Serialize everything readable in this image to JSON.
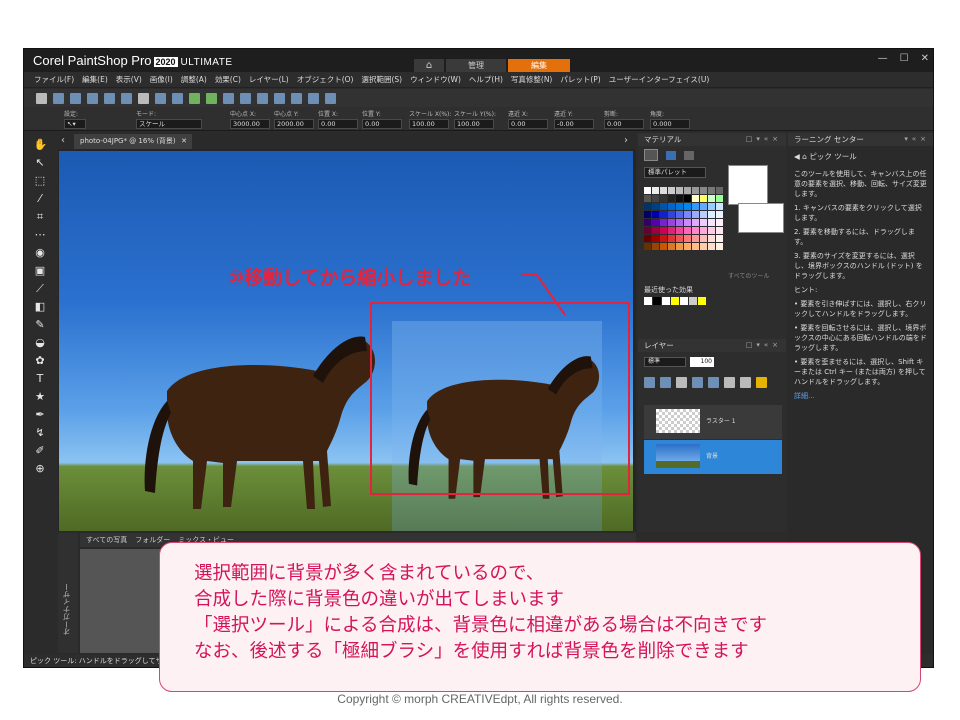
{
  "app": {
    "brand": "Corel PaintShop Pro",
    "version": "2020",
    "edition": "ULTIMATE",
    "tabs": [
      "管理",
      "編集"
    ],
    "window_controls": [
      "—",
      "☐",
      "✕"
    ]
  },
  "menu": [
    "ファイル(F)",
    "編集(E)",
    "表示(V)",
    "画像(I)",
    "調整(A)",
    "効果(C)",
    "レイヤー(L)",
    "オブジェクト(O)",
    "選択範囲(S)",
    "ウィンドウ(W)",
    "ヘルプ(H)",
    "写真修整(N)",
    "パレット(P)",
    "ユーザーインターフェイス(U)"
  ],
  "options": {
    "preset_label": "設定:",
    "mode_label": "モード:",
    "mode_value": "スケール",
    "center_x_label": "中心点 X:",
    "center_x": "3000.00",
    "center_y_label": "中心点 Y:",
    "center_y": "2000.00",
    "pos_x_label": "位置 X:",
    "pos_x": "0.00",
    "pos_y_label": "位置 Y:",
    "pos_y": "0.00",
    "scale_x_label": "スケール X(%):",
    "scale_x": "100.00",
    "scale_y_label": "スケール Y(%):",
    "scale_y": "100.00",
    "skew_x_label": "遠近 X:",
    "skew_x": "0.00",
    "skew_y_label": "遠近 Y:",
    "skew_y": "-0.00",
    "shear_label": "剪断:",
    "shear": "0.00",
    "angle_label": "角度:",
    "angle": "0.000"
  },
  "document": {
    "tab_title": "photo-04JPG* @ 16% (背景)",
    "close": "✕"
  },
  "annotation_text": "⑩移動してから縮小しました",
  "organizer": {
    "side_label": "オーガナイザー",
    "bar_labels": [
      "すべての写真",
      "フォルダー",
      "ミックス・ビュー"
    ]
  },
  "materials": {
    "title": "マテリアル",
    "palette_select": "標準パレット",
    "all_tools": "すべてのツール",
    "recent_label": "最近使った効果",
    "swatches": [
      "#ffffff",
      "#eeeeee",
      "#dddddd",
      "#cccccc",
      "#bbbbbb",
      "#aaaaaa",
      "#999999",
      "#888888",
      "#777777",
      "#666666",
      "#555555",
      "#444444",
      "#333333",
      "#222222",
      "#111111",
      "#000000",
      "#ffffcc",
      "#ffff66",
      "#ccffcc",
      "#99ff99",
      "#003366",
      "#004080",
      "#0055aa",
      "#0066cc",
      "#0077dd",
      "#0088ee",
      "#3399ff",
      "#66aaff",
      "#99ccff",
      "#cce6ff",
      "#000066",
      "#0000aa",
      "#1122cc",
      "#3344dd",
      "#5566ee",
      "#7788ff",
      "#99aaff",
      "#bbccff",
      "#ddeeff",
      "#eef4ff",
      "#330066",
      "#5500aa",
      "#7722cc",
      "#9944dd",
      "#aa66ee",
      "#cc88ff",
      "#ddaaff",
      "#eeccff",
      "#f4e6ff",
      "#fff0ff",
      "#660033",
      "#990044",
      "#cc0055",
      "#dd2277",
      "#ee4499",
      "#ff66bb",
      "#ff88cc",
      "#ffaadd",
      "#ffcce6",
      "#ffe6f2",
      "#660000",
      "#990000",
      "#cc1111",
      "#dd3333",
      "#ee5555",
      "#ff7777",
      "#ff9999",
      "#ffbbbb",
      "#ffdddd",
      "#fff0f0",
      "#663300",
      "#994400",
      "#cc5500",
      "#dd7722",
      "#ee9944",
      "#ffaa66",
      "#ffbb88",
      "#ffccaa",
      "#ffddcc",
      "#fff0e6"
    ],
    "recent": [
      "#ffffff",
      "#000000",
      "#ffffff",
      "#ffff00",
      "#ffffff",
      "#cccccc",
      "#ffff00"
    ]
  },
  "layers": {
    "title": "レイヤー",
    "blend": "標準",
    "opacity": "100",
    "items": [
      "ラスター 1",
      "背景"
    ]
  },
  "learning": {
    "title": "ラーニング センター",
    "section": "ピック ツール",
    "intro": "このツールを使用して、キャンバス上の任意の要素を選択、移動、回転、サイズ変更します。",
    "steps": [
      "1. キャンバスの要素をクリックして選択します。",
      "2. 要素を移動するには、ドラッグします。",
      "3. 要素のサイズを変更するには、選択し、境界ボックスのハンドル (ドット) をドラッグします。"
    ],
    "hint_title": "ヒント:",
    "hints": [
      "• 要素を引き伸ばすには、選択し、右クリックしてハンドルをドラッグします。",
      "• 要素を回転させるには、選択し、境界ボックスの中心にある回転ハンドルの端をドラッグします。",
      "• 要素を歪ませるには、選択し、Shift キーまたは Ctrl キー (または両方) を押してハンドルをドラッグします。"
    ],
    "link": "詳細..."
  },
  "status": "ピック ツール: ハンドルをドラッグしてサイズ変",
  "callout_lines": [
    "選択範囲に背景が多く含まれているので、",
    "合成した際に背景色の違いが出てしまいます",
    "「選択ツール」による合成は、背景色に相違がある場合は不向きです",
    "なお、後述する「極細ブラシ」を使用すれば背景色を削除できます"
  ],
  "copyright": "Copyright © morph CREATIVEdpt, All rights reserved."
}
